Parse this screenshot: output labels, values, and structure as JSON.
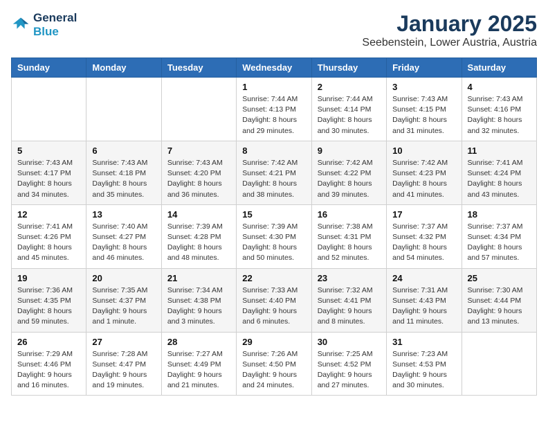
{
  "logo": {
    "line1": "General",
    "line2": "Blue"
  },
  "title": "January 2025",
  "subtitle": "Seebenstein, Lower Austria, Austria",
  "weekdays": [
    "Sunday",
    "Monday",
    "Tuesday",
    "Wednesday",
    "Thursday",
    "Friday",
    "Saturday"
  ],
  "weeks": [
    [
      {
        "day": "",
        "info": ""
      },
      {
        "day": "",
        "info": ""
      },
      {
        "day": "",
        "info": ""
      },
      {
        "day": "1",
        "info": "Sunrise: 7:44 AM\nSunset: 4:13 PM\nDaylight: 8 hours and 29 minutes."
      },
      {
        "day": "2",
        "info": "Sunrise: 7:44 AM\nSunset: 4:14 PM\nDaylight: 8 hours and 30 minutes."
      },
      {
        "day": "3",
        "info": "Sunrise: 7:43 AM\nSunset: 4:15 PM\nDaylight: 8 hours and 31 minutes."
      },
      {
        "day": "4",
        "info": "Sunrise: 7:43 AM\nSunset: 4:16 PM\nDaylight: 8 hours and 32 minutes."
      }
    ],
    [
      {
        "day": "5",
        "info": "Sunrise: 7:43 AM\nSunset: 4:17 PM\nDaylight: 8 hours and 34 minutes."
      },
      {
        "day": "6",
        "info": "Sunrise: 7:43 AM\nSunset: 4:18 PM\nDaylight: 8 hours and 35 minutes."
      },
      {
        "day": "7",
        "info": "Sunrise: 7:43 AM\nSunset: 4:20 PM\nDaylight: 8 hours and 36 minutes."
      },
      {
        "day": "8",
        "info": "Sunrise: 7:42 AM\nSunset: 4:21 PM\nDaylight: 8 hours and 38 minutes."
      },
      {
        "day": "9",
        "info": "Sunrise: 7:42 AM\nSunset: 4:22 PM\nDaylight: 8 hours and 39 minutes."
      },
      {
        "day": "10",
        "info": "Sunrise: 7:42 AM\nSunset: 4:23 PM\nDaylight: 8 hours and 41 minutes."
      },
      {
        "day": "11",
        "info": "Sunrise: 7:41 AM\nSunset: 4:24 PM\nDaylight: 8 hours and 43 minutes."
      }
    ],
    [
      {
        "day": "12",
        "info": "Sunrise: 7:41 AM\nSunset: 4:26 PM\nDaylight: 8 hours and 45 minutes."
      },
      {
        "day": "13",
        "info": "Sunrise: 7:40 AM\nSunset: 4:27 PM\nDaylight: 8 hours and 46 minutes."
      },
      {
        "day": "14",
        "info": "Sunrise: 7:39 AM\nSunset: 4:28 PM\nDaylight: 8 hours and 48 minutes."
      },
      {
        "day": "15",
        "info": "Sunrise: 7:39 AM\nSunset: 4:30 PM\nDaylight: 8 hours and 50 minutes."
      },
      {
        "day": "16",
        "info": "Sunrise: 7:38 AM\nSunset: 4:31 PM\nDaylight: 8 hours and 52 minutes."
      },
      {
        "day": "17",
        "info": "Sunrise: 7:37 AM\nSunset: 4:32 PM\nDaylight: 8 hours and 54 minutes."
      },
      {
        "day": "18",
        "info": "Sunrise: 7:37 AM\nSunset: 4:34 PM\nDaylight: 8 hours and 57 minutes."
      }
    ],
    [
      {
        "day": "19",
        "info": "Sunrise: 7:36 AM\nSunset: 4:35 PM\nDaylight: 8 hours and 59 minutes."
      },
      {
        "day": "20",
        "info": "Sunrise: 7:35 AM\nSunset: 4:37 PM\nDaylight: 9 hours and 1 minute."
      },
      {
        "day": "21",
        "info": "Sunrise: 7:34 AM\nSunset: 4:38 PM\nDaylight: 9 hours and 3 minutes."
      },
      {
        "day": "22",
        "info": "Sunrise: 7:33 AM\nSunset: 4:40 PM\nDaylight: 9 hours and 6 minutes."
      },
      {
        "day": "23",
        "info": "Sunrise: 7:32 AM\nSunset: 4:41 PM\nDaylight: 9 hours and 8 minutes."
      },
      {
        "day": "24",
        "info": "Sunrise: 7:31 AM\nSunset: 4:43 PM\nDaylight: 9 hours and 11 minutes."
      },
      {
        "day": "25",
        "info": "Sunrise: 7:30 AM\nSunset: 4:44 PM\nDaylight: 9 hours and 13 minutes."
      }
    ],
    [
      {
        "day": "26",
        "info": "Sunrise: 7:29 AM\nSunset: 4:46 PM\nDaylight: 9 hours and 16 minutes."
      },
      {
        "day": "27",
        "info": "Sunrise: 7:28 AM\nSunset: 4:47 PM\nDaylight: 9 hours and 19 minutes."
      },
      {
        "day": "28",
        "info": "Sunrise: 7:27 AM\nSunset: 4:49 PM\nDaylight: 9 hours and 21 minutes."
      },
      {
        "day": "29",
        "info": "Sunrise: 7:26 AM\nSunset: 4:50 PM\nDaylight: 9 hours and 24 minutes."
      },
      {
        "day": "30",
        "info": "Sunrise: 7:25 AM\nSunset: 4:52 PM\nDaylight: 9 hours and 27 minutes."
      },
      {
        "day": "31",
        "info": "Sunrise: 7:23 AM\nSunset: 4:53 PM\nDaylight: 9 hours and 30 minutes."
      },
      {
        "day": "",
        "info": ""
      }
    ]
  ]
}
